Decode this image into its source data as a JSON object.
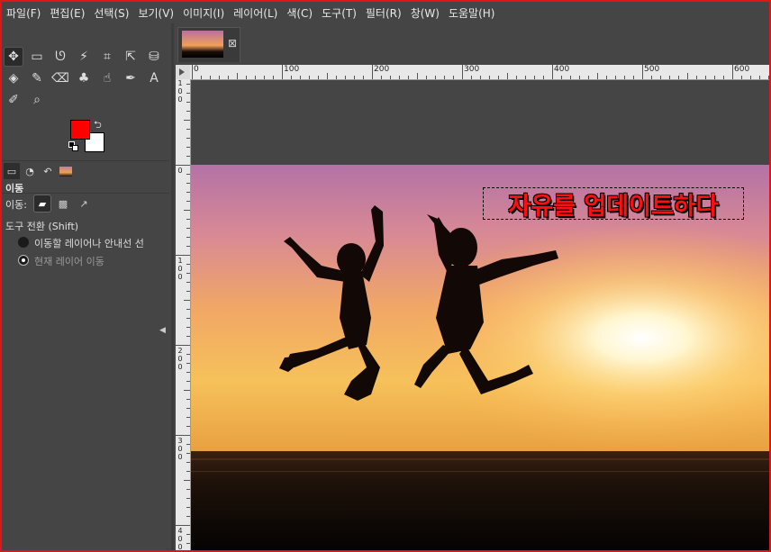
{
  "menubar": {
    "items": [
      "파일(F)",
      "편집(E)",
      "선택(S)",
      "보기(V)",
      "이미지(I)",
      "레이어(L)",
      "색(C)",
      "도구(T)",
      "필터(R)",
      "창(W)",
      "도움말(H)"
    ]
  },
  "toolbox": {
    "tools": [
      {
        "name": "move-tool",
        "glyph": "✥",
        "active": true
      },
      {
        "name": "rect-select-tool",
        "glyph": "▭"
      },
      {
        "name": "lasso-tool",
        "glyph": "ᘎ"
      },
      {
        "name": "fuzzy-select-tool",
        "glyph": "⚡"
      },
      {
        "name": "crop-tool",
        "glyph": "⌗"
      },
      {
        "name": "unified-transform-tool",
        "glyph": "⇱"
      },
      {
        "name": "warp-transform-tool",
        "glyph": "⛁"
      },
      {
        "name": "bucket-fill-tool",
        "glyph": "◈"
      },
      {
        "name": "paintbrush-tool",
        "glyph": "✎"
      },
      {
        "name": "eraser-tool",
        "glyph": "⌫"
      },
      {
        "name": "clone-tool",
        "glyph": "♣"
      },
      {
        "name": "smudge-tool",
        "glyph": "☝"
      },
      {
        "name": "paths-tool",
        "glyph": "✒"
      },
      {
        "name": "text-tool",
        "glyph": "A"
      },
      {
        "name": "color-picker-tool",
        "glyph": "✐"
      },
      {
        "name": "zoom-tool",
        "glyph": "⌕"
      }
    ],
    "colors": {
      "foreground": "#ff0000",
      "background": "#ffffff"
    }
  },
  "tool_options": {
    "title": "이동",
    "mode_label": "이동:",
    "toggle_label": "도구 전환 (Shift)",
    "option1": "이동할 레이어나 안내선 선",
    "option2": "현재 레이어 이동"
  },
  "ruler": {
    "top_labels": [
      "0",
      "100",
      "200",
      "300",
      "400",
      "500",
      "600"
    ],
    "left_labels": [
      "1\n0\n0",
      "0",
      "1\n0\n0",
      "2\n0\n0",
      "3\n0\n0",
      "4\n0\n0"
    ]
  },
  "image": {
    "caption": "자유를 업데이트하다"
  },
  "colors": {
    "ui_bg": "#454545",
    "frame": "#e01515",
    "caption": "#ff1010"
  }
}
